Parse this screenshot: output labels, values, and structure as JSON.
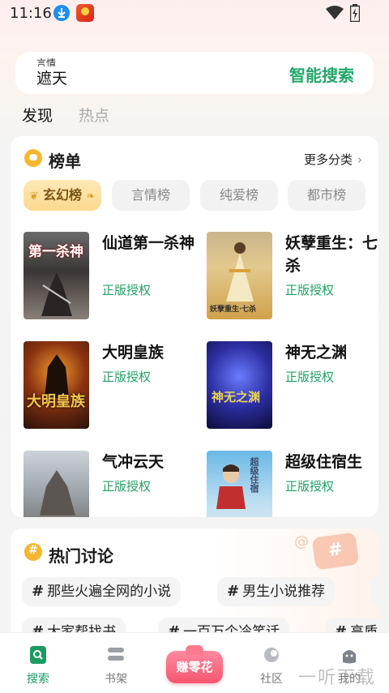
{
  "status": {
    "time": "11:16"
  },
  "search": {
    "hint_partial": "言情",
    "value": "遮天",
    "button": "智能搜索"
  },
  "tabs": [
    {
      "label": "发现"
    },
    {
      "label": "热点"
    }
  ],
  "ranking": {
    "title": "榜单",
    "more": "更多分类",
    "chips": [
      "玄幻榜",
      "言情榜",
      "纯爱榜",
      "都市榜"
    ],
    "books": [
      {
        "title": "仙道第一杀神",
        "tag": "正版授权",
        "cover_text": "第一杀神"
      },
      {
        "title": "妖孽重生：七杀",
        "tag": "正版授权",
        "cover_text": "妖孽重生·七杀"
      },
      {
        "title": "大明皇族",
        "tag": "正版授权",
        "cover_text": "大明皇族"
      },
      {
        "title": "神无之渊",
        "tag": "正版授权",
        "cover_text": "神无之渊"
      },
      {
        "title": "气冲云天",
        "tag": "正版授权",
        "cover_text": ""
      },
      {
        "title": "超级住宿生",
        "tag": "正版授权",
        "cover_text": "超级住宿"
      }
    ]
  },
  "discussion": {
    "title": "热门讨论",
    "topics": [
      "那些火遍全网的小说",
      "男生小说推荐",
      "大家帮找书",
      "一百万个冷笑话",
      "高质"
    ]
  },
  "nav": {
    "search": "搜索",
    "shelf": "书架",
    "earn": "赚零花",
    "community": "社区",
    "mine": "我的"
  },
  "watermark": "一听下载",
  "colors": {
    "accent": "#23a86a",
    "gold": "#f5b731"
  }
}
